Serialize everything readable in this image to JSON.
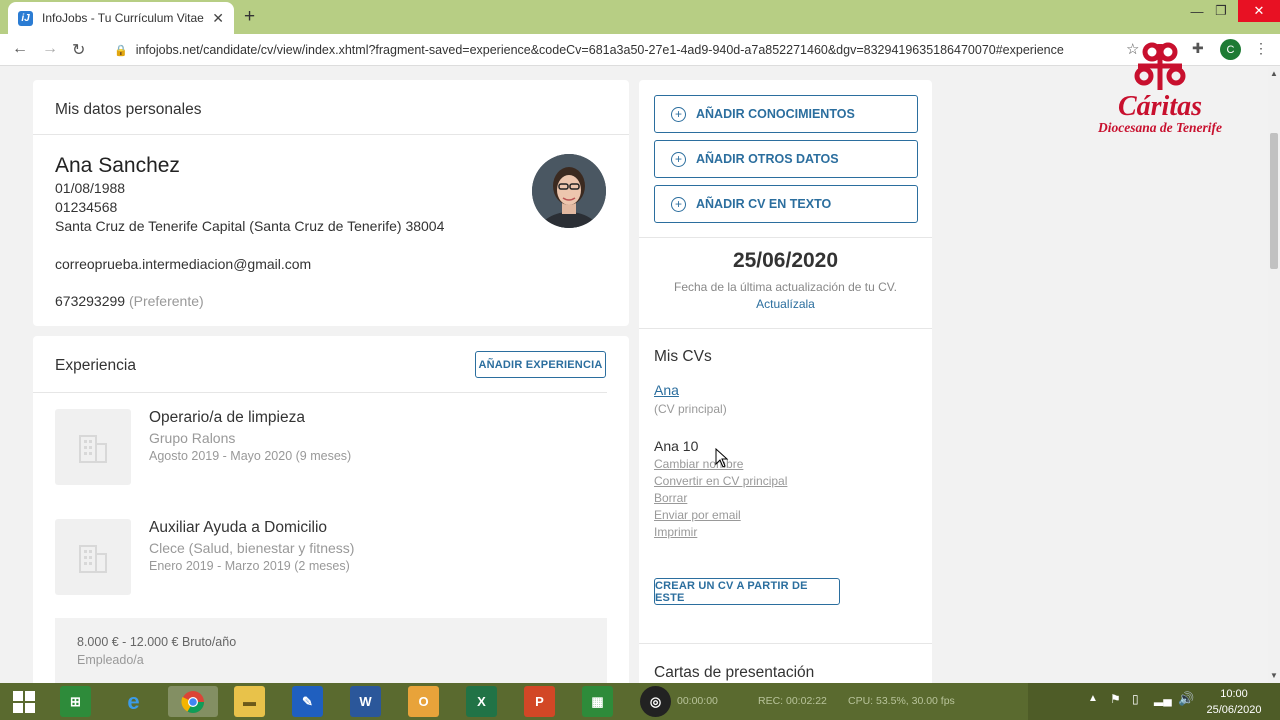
{
  "browser": {
    "tab_title": "InfoJobs - Tu Currículum Vitae",
    "favicon_letter": "iJ",
    "url": "infojobs.net/candidate/cv/view/index.xhtml?fragment-saved=experience&codeCv=681a3a50-27e1-4ad9-940d-a7a852271460&dgv=8329419635186470070#experience",
    "profile_initial": "C"
  },
  "personal": {
    "section_title": "Mis datos personales",
    "name": "Ana Sanchez",
    "birth_date": "01/08/1988",
    "id_number": "01234568",
    "address": "Santa Cruz de Tenerife Capital (Santa Cruz de Tenerife) 38004",
    "email": "correoprueba.intermediacion@gmail.com",
    "phone": "673293299",
    "phone_note": "(Preferente)"
  },
  "experience": {
    "section_title": "Experiencia",
    "add_button": "AÑADIR EXPERIENCIA",
    "items": [
      {
        "title": "Operario/a de limpieza",
        "company": "Grupo Ralons",
        "dates": "Agosto 2019 - Mayo 2020 (9 meses)"
      },
      {
        "title": "Auxiliar Ayuda a Domicilio",
        "company": "Clece (Salud, bienestar y fitness)",
        "dates": "Enero 2019 - Marzo 2019 (2 meses)"
      }
    ],
    "salary": "8.000 € - 12.000 € Bruto/año",
    "employment_type": "Empleado/a"
  },
  "sidebar": {
    "add_buttons": [
      "AÑADIR CONOCIMIENTOS",
      "AÑADIR OTROS DATOS",
      "AÑADIR CV EN TEXTO"
    ],
    "update_date": "25/06/2020",
    "update_text": "Fecha de la última actualización de tu CV.",
    "update_link": "Actualízala",
    "my_cvs_title": "Mis CVs",
    "cv_main_name": "Ana",
    "cv_main_note": "(CV principal)",
    "cv_second_name": "Ana 10",
    "cv_actions": [
      "Cambiar nombre",
      "Convertir en CV principal",
      "Borrar",
      "Enviar por email",
      "Imprimir"
    ],
    "create_cv_button": "CREAR UN CV A PARTIR DE ESTE",
    "cover_letters_title": "Cartas de presentación"
  },
  "watermark": {
    "title": "Cáritas",
    "subtitle": "Diocesana de Tenerife"
  },
  "taskbar": {
    "rec_status": "REC: 00:02:22",
    "time_elapsed": "00:00:00",
    "cpu": "CPU: 53.5%, 30.00 fps",
    "clock_time": "10:00",
    "clock_date": "25/06/2020"
  },
  "colors": {
    "accent": "#2b6e9e",
    "browser_chrome": "#b7ce84",
    "taskbar": "#5a6a2f",
    "caritas_red": "#c8102e"
  }
}
